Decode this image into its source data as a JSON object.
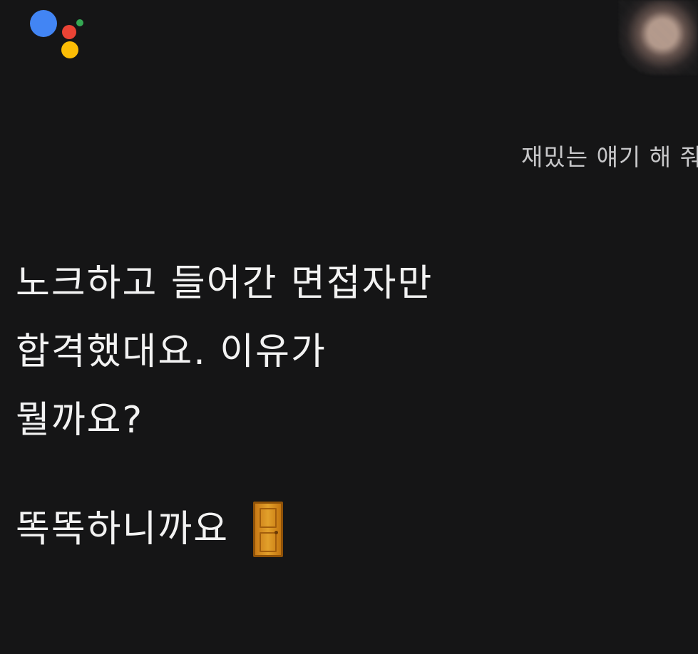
{
  "assistant": {
    "colors": {
      "blue": "#4285F4",
      "red": "#EA4335",
      "yellow": "#FBBC05",
      "green": "#34A853"
    }
  },
  "conversation": {
    "user_query": "재밌는 얘기 해 줘",
    "answer_lines": [
      "노크하고 들어간 면접자만",
      "합격했대요. 이유가",
      "뭘까요?"
    ],
    "punchline": "똑똑하니까요",
    "punchline_emoji": "door-icon"
  },
  "theme": {
    "background": "#151516",
    "primary_text": "#f2f2f2",
    "secondary_text": "#c7c7c9"
  }
}
